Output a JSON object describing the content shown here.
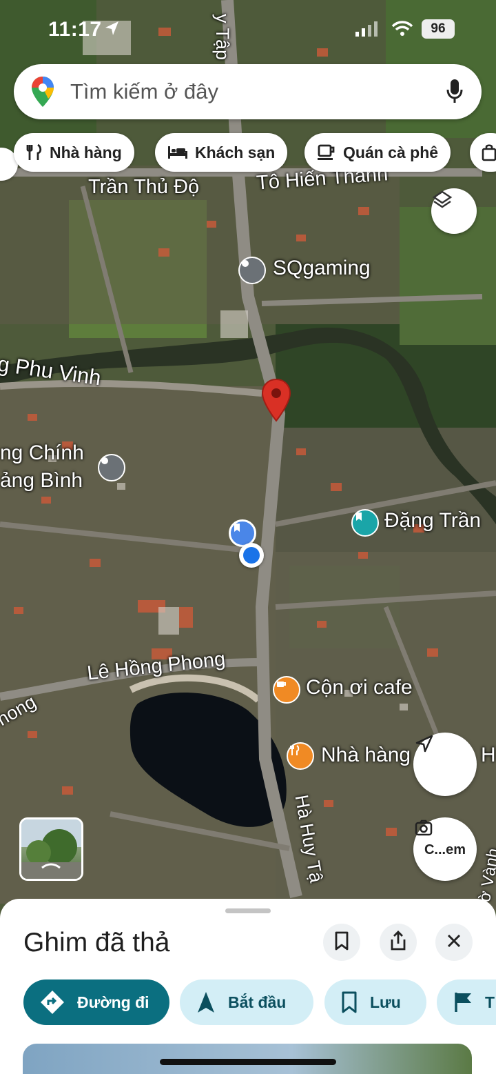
{
  "status_bar": {
    "time": "11:17",
    "battery": "96"
  },
  "search": {
    "placeholder": "Tìm kiếm ở đây"
  },
  "chips": [
    {
      "label": "Nhà hàng",
      "icon": "fork-knife-icon"
    },
    {
      "label": "Khách sạn",
      "icon": "bed-icon"
    },
    {
      "label": "Quán cà phê",
      "icon": "coffee-cup-icon"
    }
  ],
  "map": {
    "street_labels": {
      "tran_thu_do": "Trần Thủ Độ",
      "to_hien_thanh": "Tô Hiến Thành",
      "ha_huy_tap_top": "y Tập",
      "phu_vinh": "g Phu Vinh",
      "le_hong_phong": "Lê Hồng Phong",
      "phong_left": "hong",
      "ha_huy_tap": "Hà Huy Tậ",
      "right_edge": "ờ Vành"
    },
    "places": {
      "sqgaming": "SQgaming",
      "chinh_line1": "ng Chính",
      "chinh_line2": "ảng Bình",
      "dang_tran": "Đặng Trần",
      "con_oi_cafe": "Cộn ơi cafe",
      "nha_hang": "Nhà hàng",
      "nha_hang_tail": "H"
    },
    "camera_button_label": "C...em"
  },
  "sheet": {
    "title": "Ghim đã thả",
    "actions": [
      {
        "label": "Đường đi",
        "icon": "directions-icon"
      },
      {
        "label": "Bắt đầu",
        "icon": "navigation-arrow-icon"
      },
      {
        "label": "Lưu",
        "icon": "bookmark-icon"
      },
      {
        "label": "T",
        "icon": "flag-icon"
      }
    ]
  },
  "colors": {
    "accent": "#0b6f80",
    "pin_red": "#d93025",
    "user_blue": "#1a73e8"
  }
}
